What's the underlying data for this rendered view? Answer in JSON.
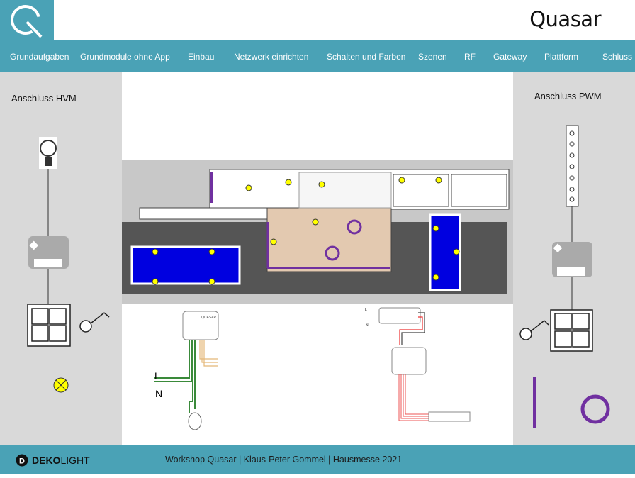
{
  "header": {
    "brand": "Quasar",
    "logo_letter": "Q"
  },
  "nav": {
    "items": [
      {
        "label": "Grundaufgaben"
      },
      {
        "label": "Grundmodule ohne App"
      },
      {
        "label": "Einbau",
        "active": true
      },
      {
        "label": "Netzwerk einrichten"
      },
      {
        "label": "Schalten und Farben"
      },
      {
        "label": "Szenen"
      },
      {
        "label": "RF"
      },
      {
        "label": "Gateway"
      },
      {
        "label": "Plattform"
      },
      {
        "label": "Schluss"
      }
    ]
  },
  "left_panel": {
    "title": "Anschluss HVM"
  },
  "right_panel": {
    "title": "Anschluss PWM"
  },
  "diagram": {
    "hvm_L": "L",
    "hvm_N": "N",
    "pwm_L": "L",
    "pwm_N": "N",
    "module_label": "QUASAR"
  },
  "footer": {
    "brand_bold": "DEKO",
    "brand_light": "LIGHT",
    "text": "Workshop Quasar | Klaus-Peter Gommel | Hausmesse 2021"
  },
  "colors": {
    "teal": "#4aa2b6",
    "panel": "#d9d9d9",
    "purple": "#7030a0",
    "pool": "#0000e0",
    "lamp": "#ffff00"
  }
}
